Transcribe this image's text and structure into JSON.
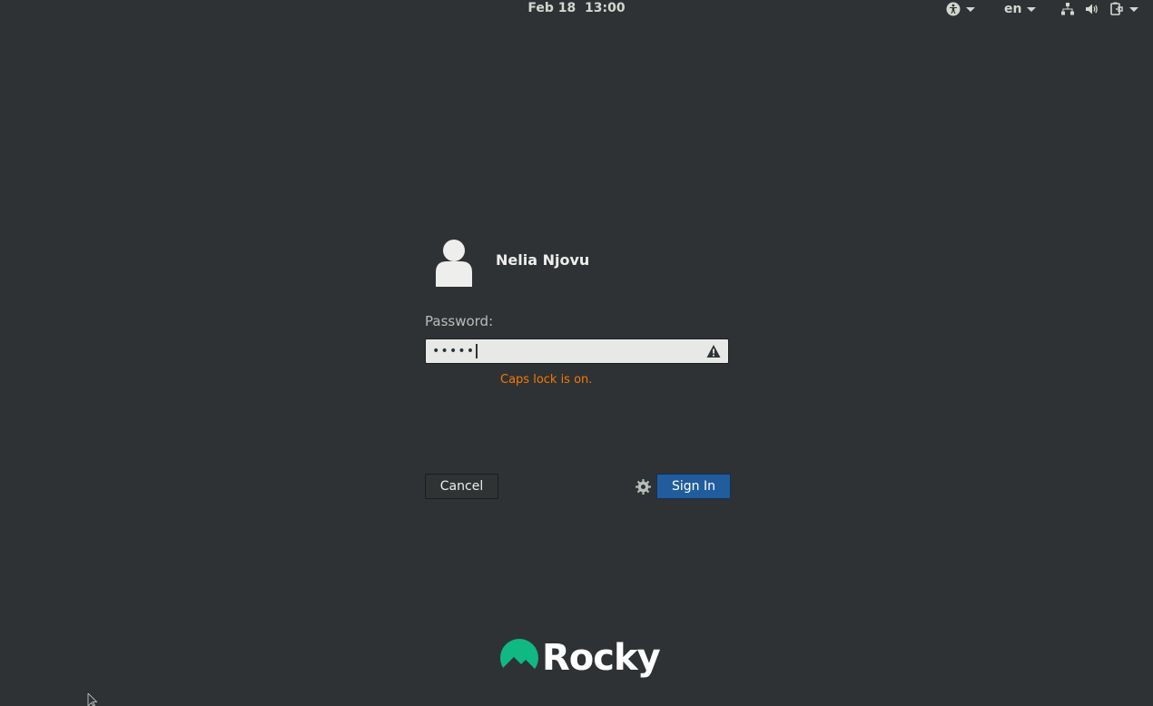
{
  "topbar": {
    "date": "Feb 18",
    "time": "13:00",
    "language": "en",
    "icons": [
      "accessibility-icon",
      "network-icon",
      "volume-icon",
      "power-icon"
    ]
  },
  "login": {
    "username": "Nelia Njovu",
    "password_label": "Password:",
    "password_value": "•••••",
    "caps_lock_message": "Caps lock is on.",
    "cancel_label": "Cancel",
    "signin_label": "Sign In"
  },
  "branding": {
    "logo_text": "Rocky",
    "logo_color": "#10b981"
  },
  "colors": {
    "background": "#2e3235",
    "accent": "#215d9c",
    "warning": "#f57900"
  }
}
